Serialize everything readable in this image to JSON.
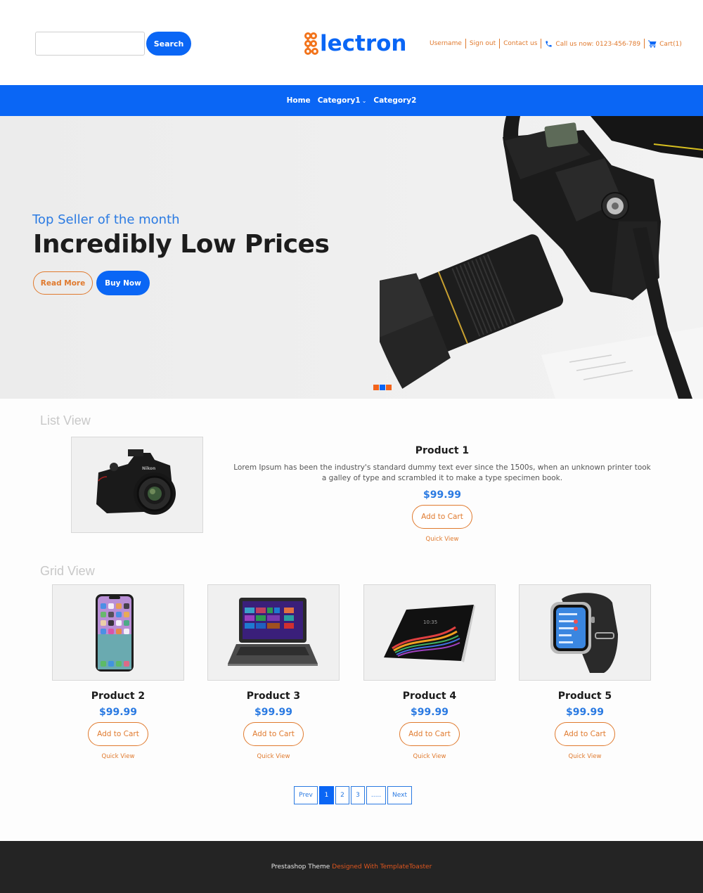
{
  "header": {
    "search": {
      "placeholder": "",
      "value": "",
      "button_label": "Search"
    },
    "logo": {
      "text": "lectron",
      "full_name": "Electron"
    },
    "links": [
      {
        "label": "Username"
      },
      {
        "label": "Sign out"
      },
      {
        "label": "Contact us"
      },
      {
        "label": "Call us now: 0123-456-789",
        "icon": "phone-icon"
      },
      {
        "label": "Cart(1)",
        "icon": "cart-icon"
      }
    ]
  },
  "nav": {
    "items": [
      {
        "label": "Home"
      },
      {
        "label": "Category1",
        "has_dropdown": true,
        "chevron": "⌵"
      },
      {
        "label": "Category2"
      }
    ]
  },
  "hero": {
    "subtitle": "Top Seller of the month",
    "title": "Incredibly Low Prices",
    "read_more_label": "Read More",
    "buy_now_label": "Buy Now",
    "image": "dslr-camera-with-lens-hood",
    "slides": [
      {
        "color": "#f2641c",
        "active": false
      },
      {
        "color": "#0a66f5",
        "active": true
      },
      {
        "color": "#f2641c",
        "active": false
      }
    ]
  },
  "list_view": {
    "title": "List View",
    "product": {
      "name": "Product 1",
      "description": "Lorem Ipsum has been the industry's standard dummy text ever since the 1500s, when an unknown printer took a galley of type and scrambled it to make a type specimen book.",
      "price": "$99.99",
      "add_to_cart_label": "Add to Cart",
      "quick_view_label": "Quick View",
      "image": "nikon-dslr-camera"
    }
  },
  "grid_view": {
    "title": "Grid View",
    "products": [
      {
        "name": "Product 2",
        "price": "$99.99",
        "add_to_cart_label": "Add to Cart",
        "quick_view_label": "Quick View",
        "image": "smartphone"
      },
      {
        "name": "Product 3",
        "price": "$99.99",
        "add_to_cart_label": "Add to Cart",
        "quick_view_label": "Quick View",
        "image": "laptop"
      },
      {
        "name": "Product 4",
        "price": "$99.99",
        "add_to_cart_label": "Add to Cart",
        "quick_view_label": "Quick View",
        "image": "tablet"
      },
      {
        "name": "Product 5",
        "price": "$99.99",
        "add_to_cart_label": "Add to Cart",
        "quick_view_label": "Quick View",
        "image": "smartwatch"
      }
    ]
  },
  "pagination": {
    "prev_label": "Prev",
    "pages": [
      "1",
      "2",
      "3",
      "....."
    ],
    "current_page": "1",
    "next_label": "Next"
  },
  "footer": {
    "text": "Prestashop Theme",
    "credit": "Designed With TemplateToaster"
  },
  "colors": {
    "brand_blue": "#0a66f5",
    "accent_orange": "#e07a2e",
    "price_blue": "#2a7ae2",
    "footer_bg": "#242424"
  }
}
